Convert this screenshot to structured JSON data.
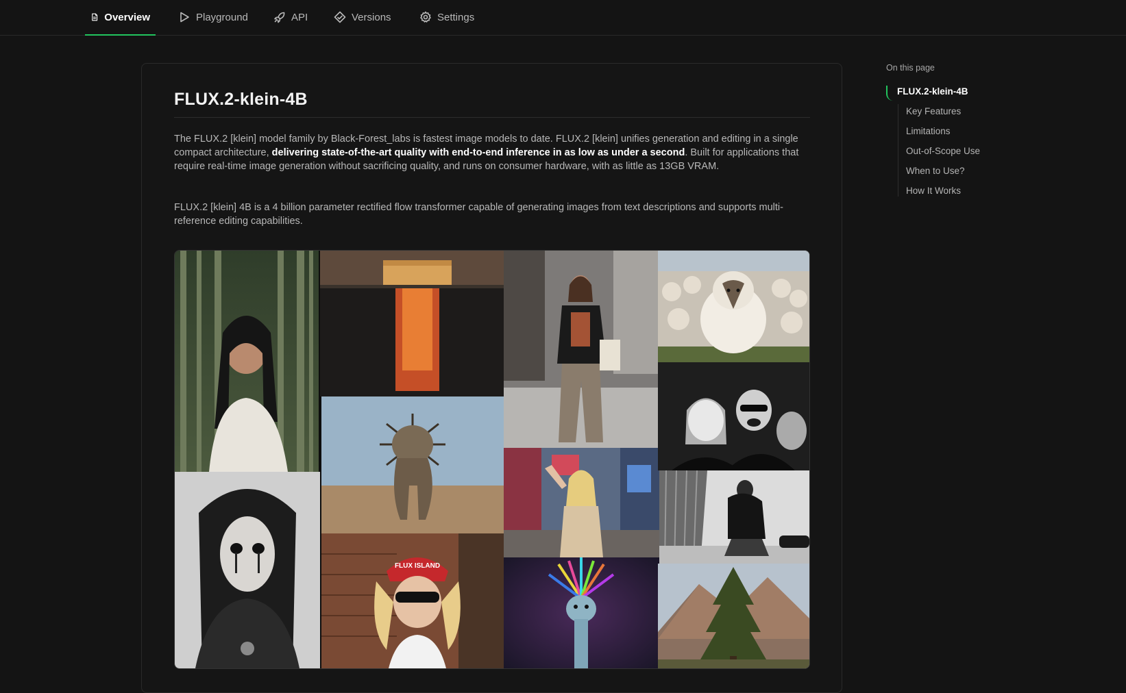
{
  "tabs": [
    {
      "label": "Overview",
      "icon": "document-icon",
      "active": true
    },
    {
      "label": "Playground",
      "icon": "play-icon",
      "active": false
    },
    {
      "label": "API",
      "icon": "rocket-icon",
      "active": false
    },
    {
      "label": "Versions",
      "icon": "diamond-icon",
      "active": false
    },
    {
      "label": "Settings",
      "icon": "gear-icon",
      "active": false
    }
  ],
  "main": {
    "title": "FLUX.2-klein-4B",
    "para1": {
      "before": "The FLUX.2 [klein] model family by Black-Forest_labs is fastest image models to date. FLUX.2 [klein] unifies generation and editing in a single compact architecture, ",
      "bold": "delivering state-of-the-art quality with end-to-end inference in as low as under a second",
      "after": ". Built for applications that require real-time image generation without sacrificing quality, and runs on consumer hardware, with as little as 13GB VRAM."
    },
    "para2": "FLUX.2 [klein] 4B is a 4 billion parameter rectified flow transformer capable of generating images from text descriptions and supports multi-reference editing capabilities.",
    "gallery_text": {
      "cap": "FLUX ISLAND"
    }
  },
  "toc": {
    "heading": "On this page",
    "items": [
      {
        "label": "FLUX.2-klein-4B",
        "active": true
      },
      {
        "label": "Key Features",
        "active": false
      },
      {
        "label": "Limitations",
        "active": false
      },
      {
        "label": "Out-of-Scope Use",
        "active": false
      },
      {
        "label": "When to Use?",
        "active": false
      },
      {
        "label": "How It Works",
        "active": false
      }
    ]
  },
  "colors": {
    "accent": "#22c55e",
    "background": "#141414"
  }
}
